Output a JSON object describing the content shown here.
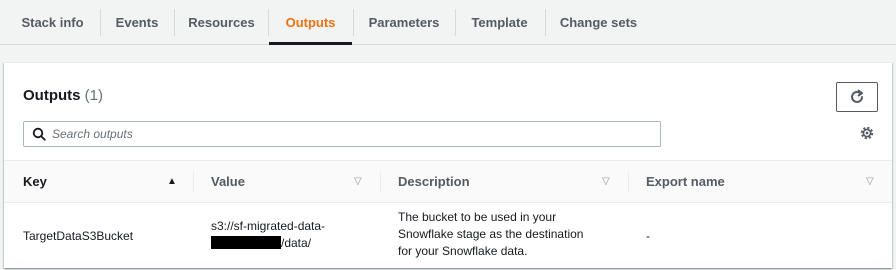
{
  "tabs": [
    {
      "label": "Stack info",
      "active": false
    },
    {
      "label": "Events",
      "active": false
    },
    {
      "label": "Resources",
      "active": false
    },
    {
      "label": "Outputs",
      "active": true
    },
    {
      "label": "Parameters",
      "active": false
    },
    {
      "label": "Template",
      "active": false
    },
    {
      "label": "Change sets",
      "active": false
    }
  ],
  "panel": {
    "title": "Outputs",
    "count": "(1)",
    "refresh_icon": "refresh-icon",
    "settings_icon": "gear-icon"
  },
  "search": {
    "placeholder": "Search outputs",
    "value": ""
  },
  "table": {
    "columns": [
      {
        "label": "Key",
        "sort": "ascending"
      },
      {
        "label": "Value",
        "sort": "none"
      },
      {
        "label": "Description",
        "sort": "none"
      },
      {
        "label": "Export name",
        "sort": "none"
      }
    ],
    "rows": [
      {
        "key": "TargetDataS3Bucket",
        "value_line1": "s3://sf-migrated-data-",
        "value_line2_suffix": "/data/",
        "description_lines": [
          "The bucket to be used in your",
          "Snowflake stage as the destination",
          "for your Snowflake data."
        ],
        "export_name": "-"
      }
    ]
  },
  "colors": {
    "active_tab": "#ec7211",
    "text": "#16191f",
    "muted": "#545b64"
  }
}
